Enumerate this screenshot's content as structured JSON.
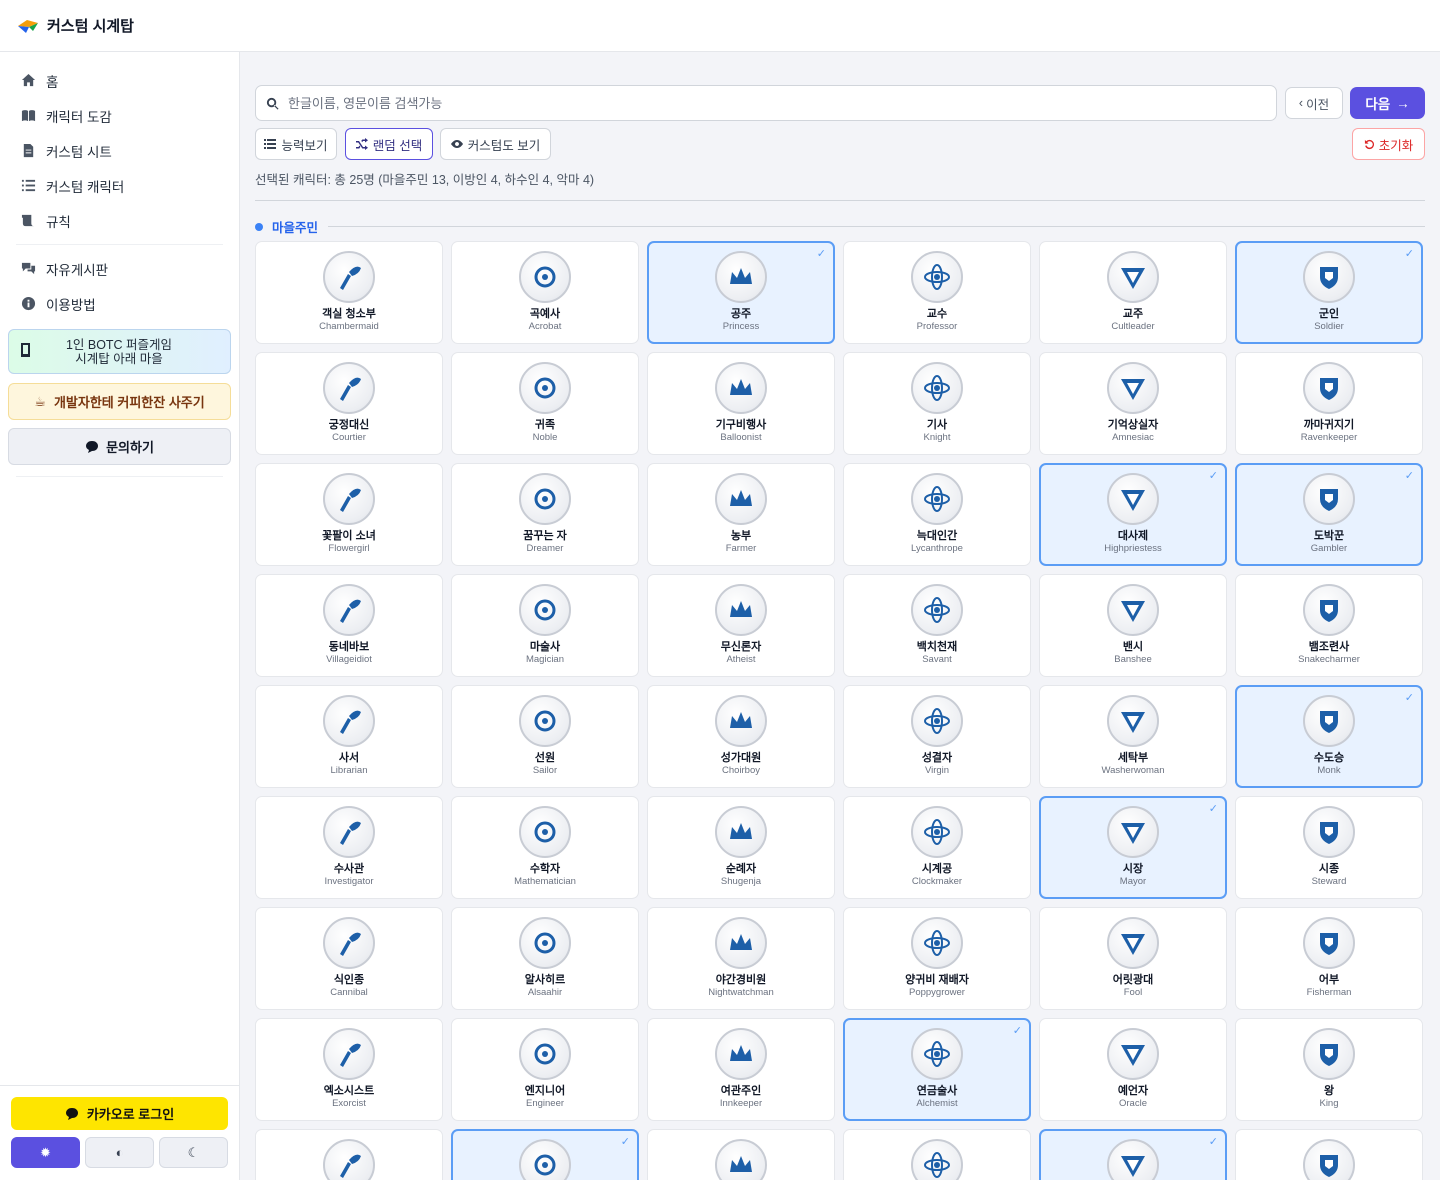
{
  "app": {
    "title": "커스텀 시계탑"
  },
  "sidebar": {
    "nav": [
      {
        "label": "홈",
        "icon": "home-icon"
      },
      {
        "label": "캐릭터 도감",
        "icon": "book-icon"
      },
      {
        "label": "커스텀 시트",
        "icon": "document-icon"
      },
      {
        "label": "커스텀 캐릭터",
        "icon": "list-icon"
      },
      {
        "label": "규칙",
        "icon": "scroll-icon"
      }
    ],
    "nav2": [
      {
        "label": "자유게시판",
        "icon": "chat-icon"
      },
      {
        "label": "이용방법",
        "icon": "info-icon"
      }
    ],
    "promo_botc": "1인 BOTC 퍼즐게임\n시계탑 아래 마을",
    "promo_botc_line1": "1인 BOTC 퍼즐게임",
    "promo_botc_line2": "시계탑 아래 마을",
    "promo_coffee": "개발자한테 커피한잔 사주기",
    "contact": "문의하기",
    "kakao_login": "카카오로 로그인",
    "theme_icons": [
      "sun-icon",
      "contrast-icon",
      "moon-icon"
    ]
  },
  "toolbar": {
    "search_placeholder": "한글이름, 영문이름 검색가능",
    "prev_label": "이전",
    "next_label": "다음",
    "ability_view": "능력보기",
    "random_select": "랜덤 선택",
    "custom_view": "커스텀도 보기",
    "reset": "초기화"
  },
  "summary": "선택된 캐릭터: 총 25명 (마을주민 13, 이방인 4, 하수인 4, 악마 4)",
  "section": {
    "label": "마을주민"
  },
  "colors": {
    "accent": "#5b50e0",
    "selected_border": "#5b9df5",
    "selected_bg": "#e8f2ff",
    "section": "#2563eb",
    "token_art": "#1d5fa8"
  },
  "characters": [
    {
      "ko": "객실 청소부",
      "en": "Chambermaid",
      "selected": false
    },
    {
      "ko": "곡예사",
      "en": "Acrobat",
      "selected": false
    },
    {
      "ko": "공주",
      "en": "Princess",
      "selected": true
    },
    {
      "ko": "교수",
      "en": "Professor",
      "selected": false
    },
    {
      "ko": "교주",
      "en": "Cultleader",
      "selected": false
    },
    {
      "ko": "군인",
      "en": "Soldier",
      "selected": true
    },
    {
      "ko": "궁정대신",
      "en": "Courtier",
      "selected": false
    },
    {
      "ko": "귀족",
      "en": "Noble",
      "selected": false
    },
    {
      "ko": "기구비행사",
      "en": "Balloonist",
      "selected": false
    },
    {
      "ko": "기사",
      "en": "Knight",
      "selected": false
    },
    {
      "ko": "기억상실자",
      "en": "Amnesiac",
      "selected": false
    },
    {
      "ko": "까마귀지기",
      "en": "Ravenkeeper",
      "selected": false
    },
    {
      "ko": "꽃팔이 소녀",
      "en": "Flowergirl",
      "selected": false
    },
    {
      "ko": "꿈꾸는 자",
      "en": "Dreamer",
      "selected": false
    },
    {
      "ko": "농부",
      "en": "Farmer",
      "selected": false
    },
    {
      "ko": "늑대인간",
      "en": "Lycanthrope",
      "selected": false
    },
    {
      "ko": "대사제",
      "en": "Highpriestess",
      "selected": true
    },
    {
      "ko": "도박꾼",
      "en": "Gambler",
      "selected": true
    },
    {
      "ko": "동네바보",
      "en": "Villageidiot",
      "selected": false
    },
    {
      "ko": "마술사",
      "en": "Magician",
      "selected": false
    },
    {
      "ko": "무신론자",
      "en": "Atheist",
      "selected": false
    },
    {
      "ko": "백치천재",
      "en": "Savant",
      "selected": false
    },
    {
      "ko": "밴시",
      "en": "Banshee",
      "selected": false
    },
    {
      "ko": "뱀조련사",
      "en": "Snakecharmer",
      "selected": false
    },
    {
      "ko": "사서",
      "en": "Librarian",
      "selected": false
    },
    {
      "ko": "선원",
      "en": "Sailor",
      "selected": false
    },
    {
      "ko": "성가대원",
      "en": "Choirboy",
      "selected": false
    },
    {
      "ko": "성결자",
      "en": "Virgin",
      "selected": false
    },
    {
      "ko": "세탁부",
      "en": "Washerwoman",
      "selected": false
    },
    {
      "ko": "수도승",
      "en": "Monk",
      "selected": true
    },
    {
      "ko": "수사관",
      "en": "Investigator",
      "selected": false
    },
    {
      "ko": "수학자",
      "en": "Mathematician",
      "selected": false
    },
    {
      "ko": "순례자",
      "en": "Shugenja",
      "selected": false
    },
    {
      "ko": "시계공",
      "en": "Clockmaker",
      "selected": false
    },
    {
      "ko": "시장",
      "en": "Mayor",
      "selected": true
    },
    {
      "ko": "시종",
      "en": "Steward",
      "selected": false
    },
    {
      "ko": "식인종",
      "en": "Cannibal",
      "selected": false
    },
    {
      "ko": "알사히르",
      "en": "Alsaahir",
      "selected": false
    },
    {
      "ko": "야간경비원",
      "en": "Nightwatchman",
      "selected": false
    },
    {
      "ko": "양귀비 재배자",
      "en": "Poppygrower",
      "selected": false
    },
    {
      "ko": "어릿광대",
      "en": "Fool",
      "selected": false
    },
    {
      "ko": "어부",
      "en": "Fisherman",
      "selected": false
    },
    {
      "ko": "엑소시스트",
      "en": "Exorcist",
      "selected": false
    },
    {
      "ko": "엔지니어",
      "en": "Engineer",
      "selected": false
    },
    {
      "ko": "여관주인",
      "en": "Innkeeper",
      "selected": false
    },
    {
      "ko": "연금술사",
      "en": "Alchemist",
      "selected": true
    },
    {
      "ko": "예언자",
      "en": "Oracle",
      "selected": false
    },
    {
      "ko": "왕",
      "en": "King",
      "selected": false
    },
    {
      "ko": "",
      "en": "",
      "selected": false
    },
    {
      "ko": "",
      "en": "",
      "selected": true
    },
    {
      "ko": "",
      "en": "",
      "selected": false
    },
    {
      "ko": "",
      "en": "",
      "selected": false
    },
    {
      "ko": "",
      "en": "",
      "selected": true
    },
    {
      "ko": "",
      "en": "",
      "selected": false
    }
  ]
}
